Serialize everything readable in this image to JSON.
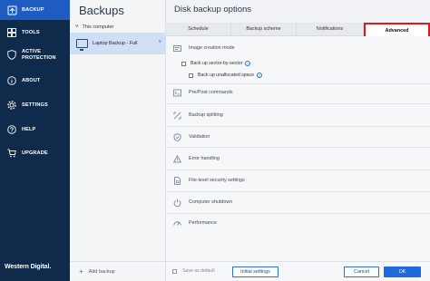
{
  "nav": {
    "items": [
      {
        "label": "BACKUP",
        "icon": "backup-icon",
        "active": true
      },
      {
        "label": "TOOLS",
        "icon": "tools-icon"
      },
      {
        "label": "ACTIVE PROTECTION",
        "icon": "shield-icon"
      },
      {
        "label": "ABOUT",
        "icon": "info-icon"
      },
      {
        "label": "SETTINGS",
        "icon": "gear-icon"
      },
      {
        "label": "HELP",
        "icon": "help-icon"
      },
      {
        "label": "UPGRADE",
        "icon": "cart-icon"
      }
    ],
    "brand": "Western Digital."
  },
  "backups": {
    "title": "Backups",
    "group_label": "This computer",
    "item_label": "Laptop Backup - Full",
    "add_label": "Add backup"
  },
  "options": {
    "title": "Disk backup options",
    "tabs": [
      "Schedule",
      "Backup scheme",
      "Notifications",
      "Advanced"
    ],
    "active_tab": "Advanced",
    "sections": [
      {
        "label": "Image creation mode",
        "icon": "disk-image-icon",
        "expanded": true
      },
      {
        "label": "Pre/Post commands",
        "icon": "terminal-icon"
      },
      {
        "label": "Backup splitting",
        "icon": "split-icon"
      },
      {
        "label": "Validation",
        "icon": "validation-icon"
      },
      {
        "label": "Error handling",
        "icon": "error-icon"
      },
      {
        "label": "File-level security settings",
        "icon": "file-lock-icon"
      },
      {
        "label": "Computer shutdown",
        "icon": "power-icon"
      },
      {
        "label": "Performance",
        "icon": "performance-icon"
      }
    ],
    "image_mode": {
      "sector_label": "Back up sector-by-sector",
      "unallocated_label": "Back up unallocated space"
    },
    "save_default_label": "Save as default",
    "initial_settings_label": "Initial settings",
    "cancel_label": "Cancel",
    "ok_label": "OK"
  },
  "colors": {
    "nav_bg": "#0f2a4a",
    "nav_active": "#1e5cc1",
    "accent": "#1e6be0",
    "highlight": "#e8141a"
  }
}
